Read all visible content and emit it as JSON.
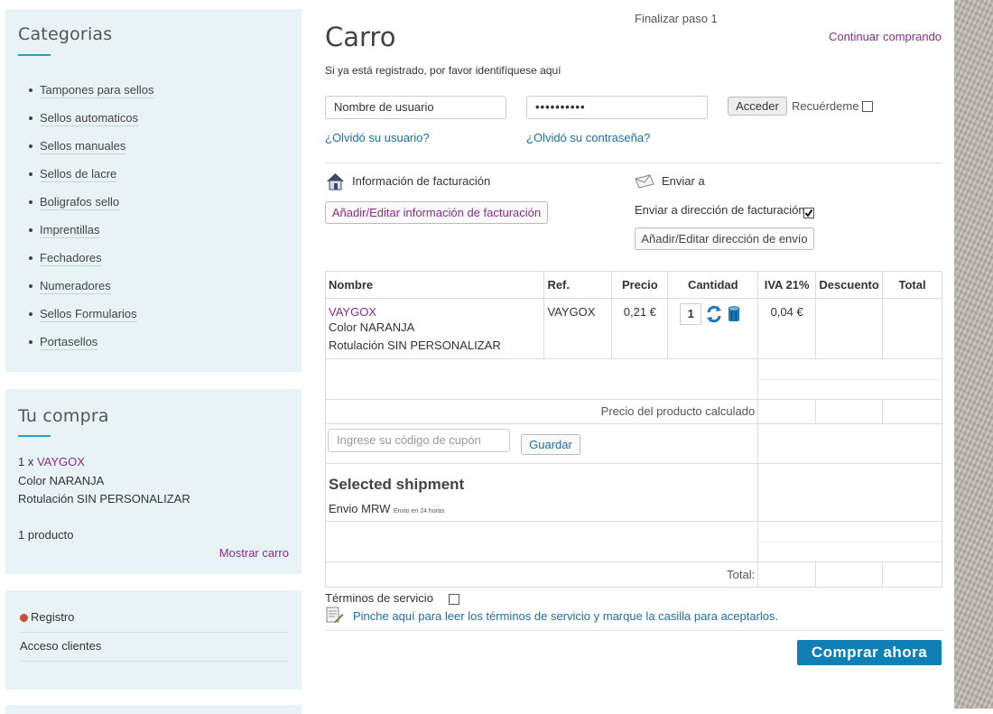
{
  "sidebar": {
    "categories": {
      "title": "Categorias",
      "items": [
        "Tampones para sellos",
        "Sellos automaticos",
        "Sellos manuales",
        "Sellos de lacre",
        "Boligrafos sello",
        "Imprentillas",
        "Fechadores",
        "Numeradores",
        "Sellos Formularios",
        "Portasellos"
      ]
    },
    "purchase": {
      "title": "Tu compra",
      "qty_prefix": "1 x",
      "product": "VAYGOX",
      "color": "Color NARANJA",
      "label": "Rotulación SIN PERSONALIZAR",
      "count": "1 producto",
      "show_cart": "Mostrar carro"
    },
    "account": {
      "register": "Registro",
      "login": "Acceso clientes"
    }
  },
  "checkout": {
    "step": "Finalizar paso 1",
    "title": "Carro",
    "continue": "Continuar comprando",
    "login_hint": "Si ya está registrado, por favor identifíquese aquí",
    "username_placeholder": "Nombre de usuario",
    "password_value": "••••••••••",
    "login_button": "Acceder",
    "remember": "Recuérdeme",
    "forgot_user": "¿Olvidó su usuario?",
    "forgot_pass": "¿Olvidó su contraseña?",
    "billing_title": "Información de facturación",
    "billing_button": "Añadir/Editar información de facturación",
    "shipping_title": "Enviar a",
    "ship_to_billing": "Enviar a dirección de facturación",
    "shipping_button": "Añadir/Editar dirección de envío"
  },
  "cart": {
    "headers": [
      "Nombre",
      "Ref.",
      "Precio",
      "Cantidad",
      "IVA 21%",
      "Descuento",
      "Total"
    ],
    "item": {
      "name": "VAYGOX",
      "color": "Color NARANJA",
      "label": "Rotulación SIN PERSONALIZAR",
      "ref": "VAYGOX",
      "price": "0,21 €",
      "qty": "1",
      "iva": "0,04 €"
    },
    "price_calc": "Precio del producto calculado",
    "coupon_placeholder": "Ingrese su código de cupón",
    "coupon_button": "Guardar",
    "shipment_title": "Selected shipment",
    "shipment_method": "Envio MRW",
    "shipment_note": "Envio en 24 horas",
    "total_label": "Total:"
  },
  "terms": {
    "label": "Términos de servicio",
    "link": "Pinche aquí para leer los términos de servicio y marque la casilla para aceptarlos."
  },
  "buy_button": "Comprar ahora",
  "colors": {
    "accent_purple": "#8a2b91",
    "accent_blue": "#0f7fb4",
    "sidebar_bg": "#e7f3f4"
  }
}
